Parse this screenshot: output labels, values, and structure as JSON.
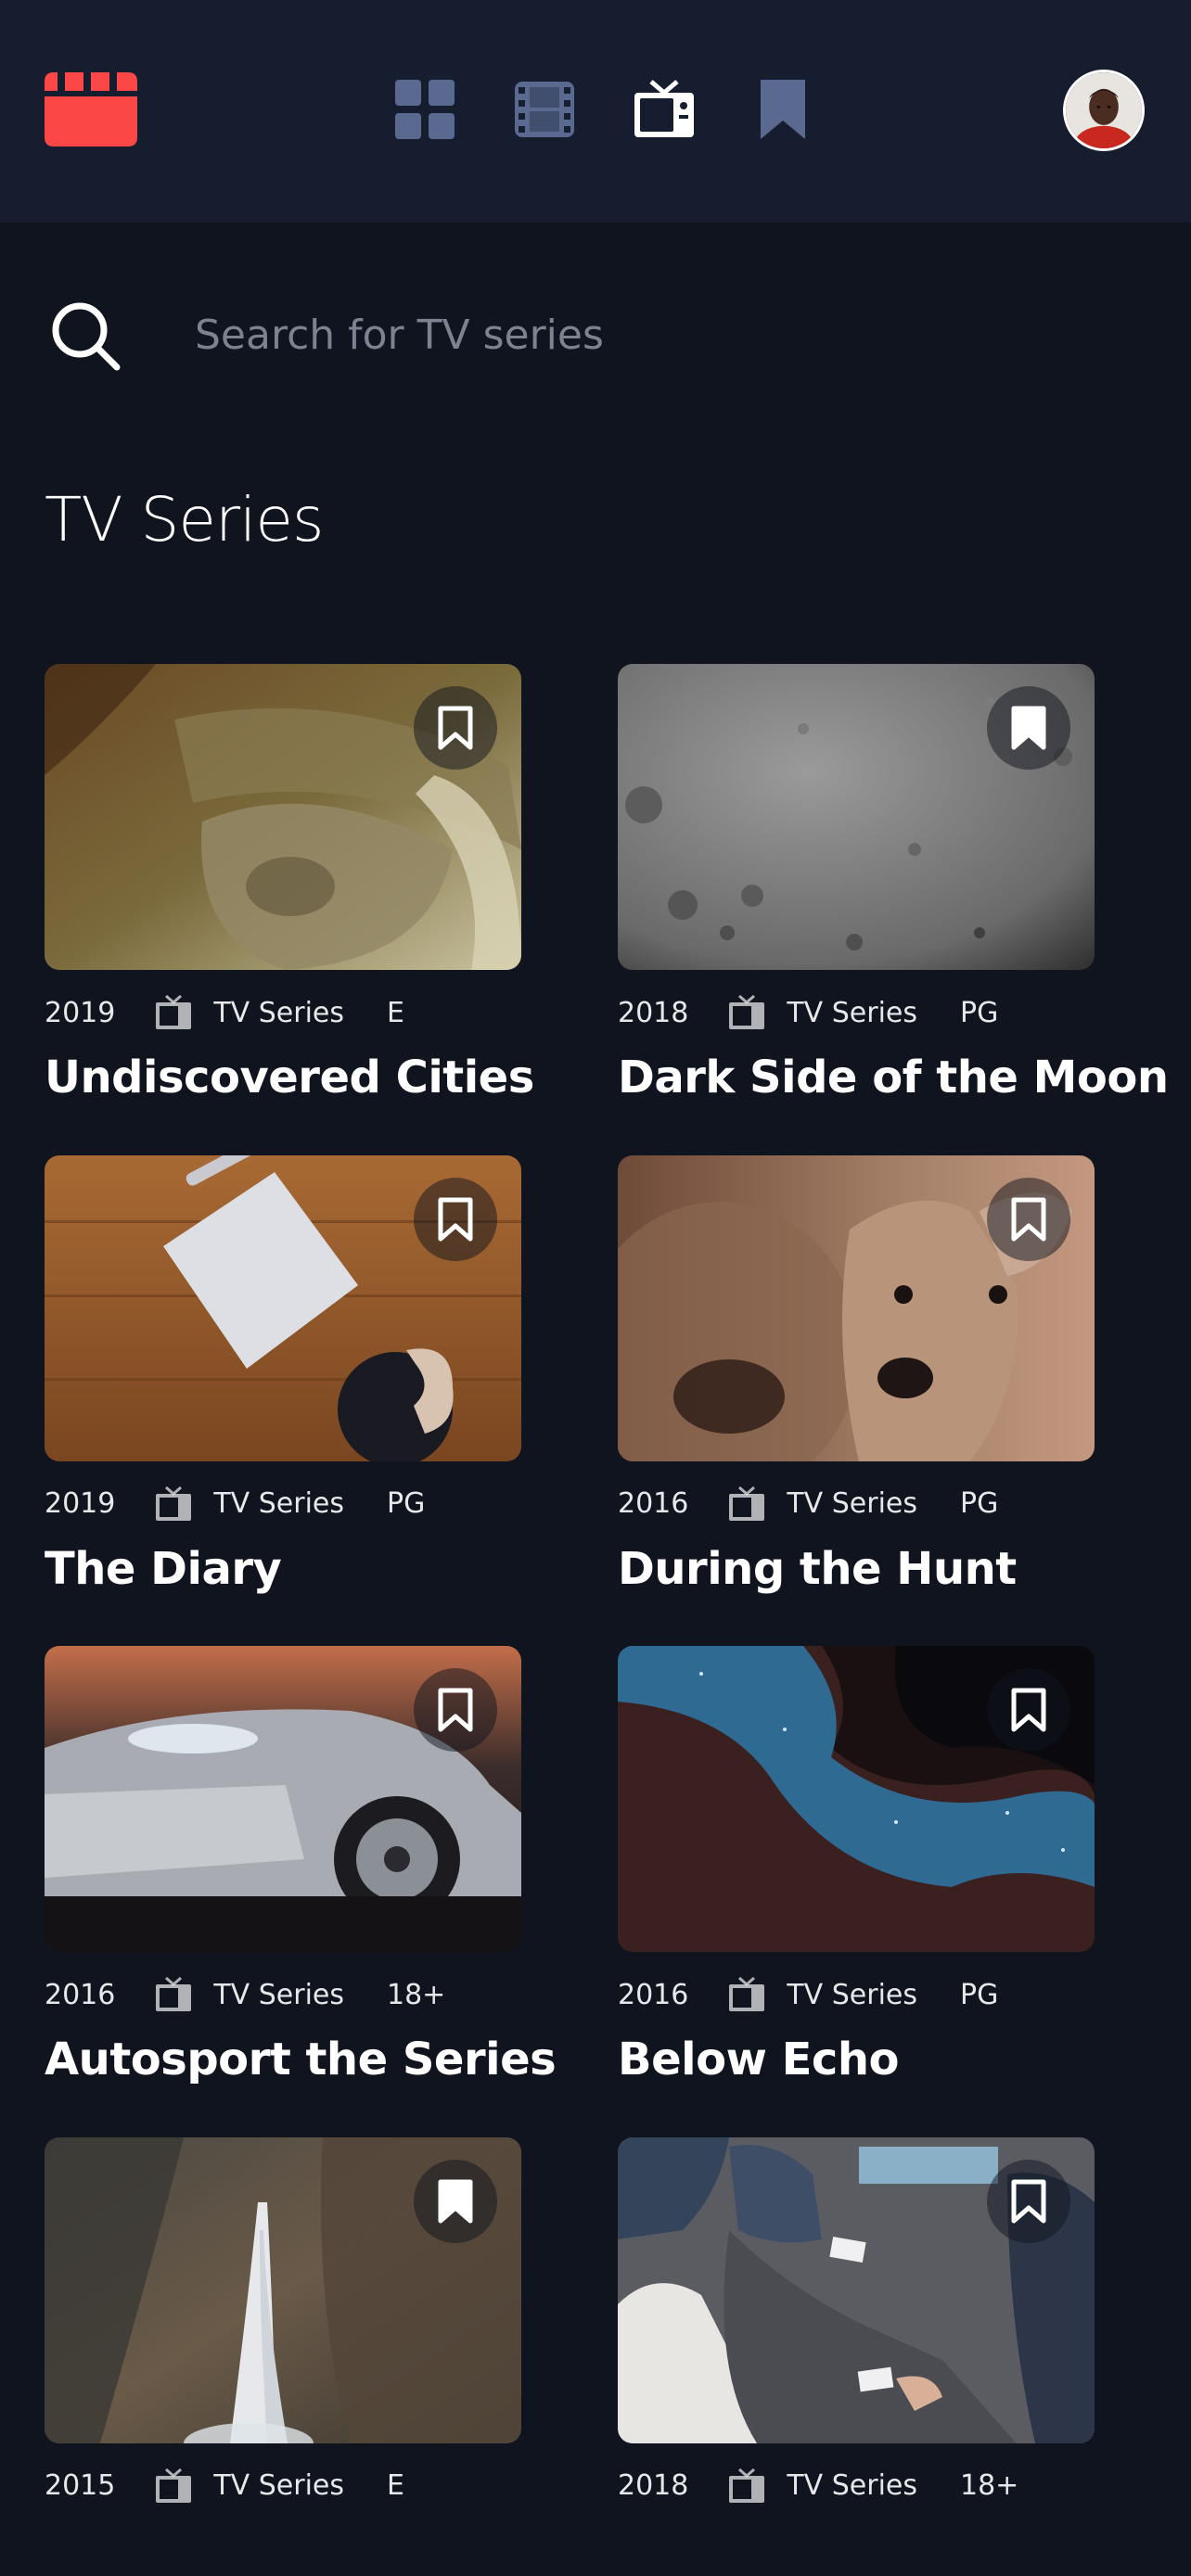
{
  "colors": {
    "background": "#10141e",
    "nav_background": "#161d2f",
    "accent": "#fc4747",
    "nav_icon_inactive": "#5a698f",
    "nav_icon_active": "#ffffff"
  },
  "nav": {
    "logo_icon": "movie-clapper-icon",
    "items": [
      {
        "icon": "grid-icon",
        "name": "home",
        "active": false
      },
      {
        "icon": "film-icon",
        "name": "movies",
        "active": false
      },
      {
        "icon": "tv-icon",
        "name": "tv-series",
        "active": true
      },
      {
        "icon": "bookmark-icon",
        "name": "bookmarks",
        "active": false
      }
    ],
    "avatar_icon": "user-avatar"
  },
  "search": {
    "icon": "search-icon",
    "placeholder": "Search for TV series",
    "value": ""
  },
  "section": {
    "title": "TV Series"
  },
  "shows": [
    {
      "year": "2019",
      "category": "TV Series",
      "category_icon": "tv-icon",
      "rating": "E",
      "title": "Undiscovered Cities",
      "bookmarked": false
    },
    {
      "year": "2018",
      "category": "TV Series",
      "category_icon": "tv-icon",
      "rating": "PG",
      "title": "Dark Side of the Moon",
      "bookmarked": true
    },
    {
      "year": "2019",
      "category": "TV Series",
      "category_icon": "tv-icon",
      "rating": "PG",
      "title": "The Diary",
      "bookmarked": false
    },
    {
      "year": "2016",
      "category": "TV Series",
      "category_icon": "tv-icon",
      "rating": "PG",
      "title": "During the Hunt",
      "bookmarked": false
    },
    {
      "year": "2016",
      "category": "TV Series",
      "category_icon": "tv-icon",
      "rating": "18+",
      "title": "Autosport the Series",
      "bookmarked": false
    },
    {
      "year": "2016",
      "category": "TV Series",
      "category_icon": "tv-icon",
      "rating": "PG",
      "title": "Below Echo",
      "bookmarked": false
    },
    {
      "year": "2015",
      "category": "TV Series",
      "category_icon": "tv-icon",
      "rating": "E",
      "title": "",
      "bookmarked": true
    },
    {
      "year": "2018",
      "category": "TV Series",
      "category_icon": "tv-icon",
      "rating": "18+",
      "title": "",
      "bookmarked": false
    }
  ]
}
